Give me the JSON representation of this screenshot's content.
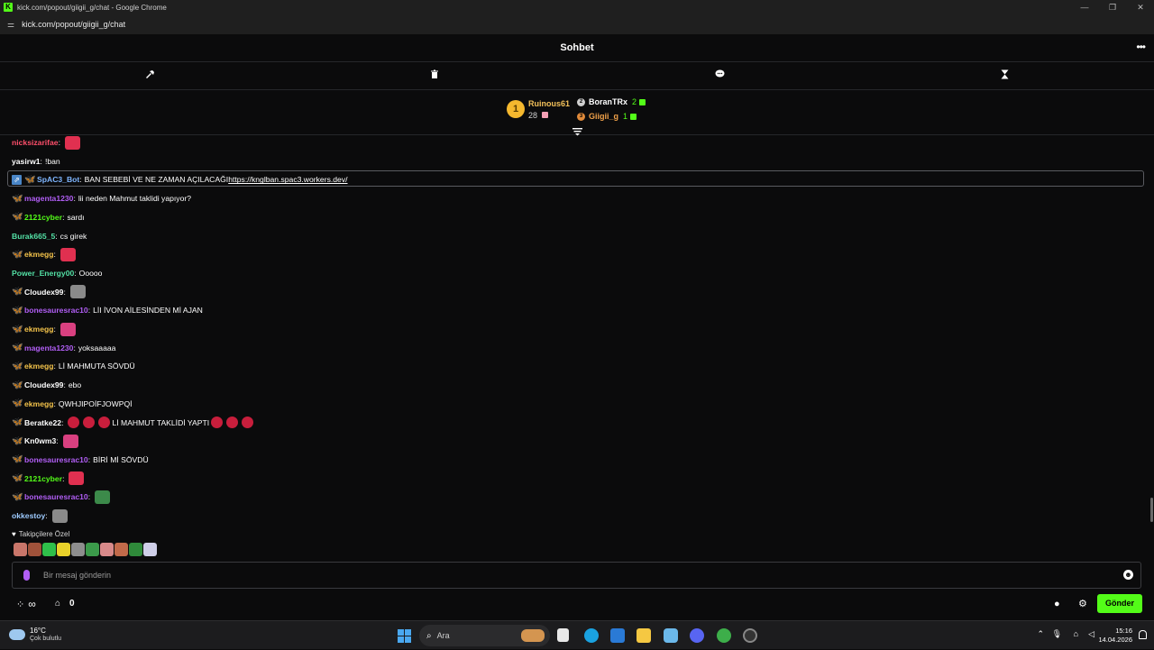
{
  "window": {
    "title": "kick.com/popout/giigii_g/chat - Google Chrome",
    "url": "kick.com/popout/giigii_g/chat"
  },
  "chat": {
    "header_title": "Sohbet",
    "more_label": "•••"
  },
  "leaderboard": {
    "first": {
      "rank": "1",
      "name": "Ruinous61",
      "count": "28"
    },
    "others": [
      {
        "rank": "2",
        "name": "BoranTRx",
        "count": "2",
        "color": "#ffffff"
      },
      {
        "rank": "3",
        "name": "Giigii_g",
        "count": "1",
        "color": "#f2a24a"
      }
    ]
  },
  "messages": [
    {
      "user": "nicksizarifae",
      "color": "#ff4f6b",
      "badges": 0,
      "text": "",
      "emotes": 1
    },
    {
      "user": "yasirw1",
      "color": "#ffffff",
      "badges": 0,
      "text": "!ban",
      "emotes": 0
    },
    {
      "user": "SpAC3_Bot",
      "color": "#7fb6ff",
      "badges": 2,
      "text": "BAN SEBEBİ VE NE ZAMAN AÇILACAĞI ",
      "link": "https://knglban.spac3.workers.dev/",
      "emotes": 0
    },
    {
      "user": "magenta1230",
      "color": "#b15ef5",
      "badges": 1,
      "text": "lii neden Mahmut taklidi yapıyor?",
      "emotes": 0
    },
    {
      "user": "2121cyber",
      "color": "#53fc18",
      "badges": 1,
      "text": "sardı",
      "emotes": 0
    },
    {
      "user": "Burak665_5",
      "color": "#53e0a5",
      "badges": 0,
      "text": "cs girek",
      "emotes": 0
    },
    {
      "user": "ekmegg",
      "color": "#f2c24a",
      "badges": 1,
      "text": "",
      "emotes": 1
    },
    {
      "user": "Power_Energy00",
      "color": "#53e0a5",
      "badges": 0,
      "text": "Ooooo",
      "emotes": 0
    },
    {
      "user": "Cloudex99",
      "color": "#ffffff",
      "badges": 1,
      "text": "",
      "emotes": 1
    },
    {
      "user": "bonesauresrac10",
      "color": "#b15ef5",
      "badges": 1,
      "text": "LİI İVON AİLESİNDEN Mİ AJAN",
      "emotes": 0
    },
    {
      "user": "ekmegg",
      "color": "#f2c24a",
      "badges": 1,
      "text": "",
      "emotes": 1
    },
    {
      "user": "magenta1230",
      "color": "#b15ef5",
      "badges": 1,
      "text": "yoksaaaaa",
      "emotes": 0
    },
    {
      "user": "ekmegg",
      "color": "#f2c24a",
      "badges": 1,
      "text": "Lİ MAHMUTA SÖVDÜ",
      "emotes": 0
    },
    {
      "user": "Cloudex99",
      "color": "#ffffff",
      "badges": 1,
      "text": "ebo",
      "emotes": 0
    },
    {
      "user": "ekmegg",
      "color": "#f2c24a",
      "badges": 1,
      "text": "QWHJIPOİFJOWPQİ",
      "emotes": 0
    },
    {
      "user": "Beratke22",
      "color": "#ffffff",
      "badges": 1,
      "text": "Lİ MAHMUT TAKLİDİ YAPTI",
      "emotes": 6
    },
    {
      "user": "Kn0wm3",
      "color": "#ffffff",
      "badges": 1,
      "text": "",
      "emotes": 1
    },
    {
      "user": "bonesauresrac10",
      "color": "#b15ef5",
      "badges": 1,
      "text": "BİRİ Mİ SÖVDÜ",
      "emotes": 0
    },
    {
      "user": "2121cyber",
      "color": "#53fc18",
      "badges": 1,
      "text": "",
      "emotes": 1
    },
    {
      "user": "bonesauresrac10",
      "color": "#b15ef5",
      "badges": 1,
      "text": "",
      "emotes": 1
    },
    {
      "user": "okkestoy",
      "color": "#9ecbff",
      "badges": 0,
      "text": "",
      "emotes": 1
    }
  ],
  "follower_emotes": {
    "label": "Takipçilere Özel",
    "colors": [
      "#c9766a",
      "#a0523a",
      "#2fbf4a",
      "#e9d12a",
      "#8e8e8e",
      "#3b9a4a",
      "#d88a8a",
      "#c26a4a",
      "#2f8a3a",
      "#cfcfe8"
    ]
  },
  "input": {
    "placeholder": "Bir mesaj gönderin"
  },
  "bottom": {
    "store_count": "0",
    "send_label": "Gönder"
  },
  "taskbar": {
    "temp": "16°C",
    "condition": "Çok bulutlu",
    "search_label": "Ara",
    "time": "15:16",
    "date": "14.04.2026"
  }
}
